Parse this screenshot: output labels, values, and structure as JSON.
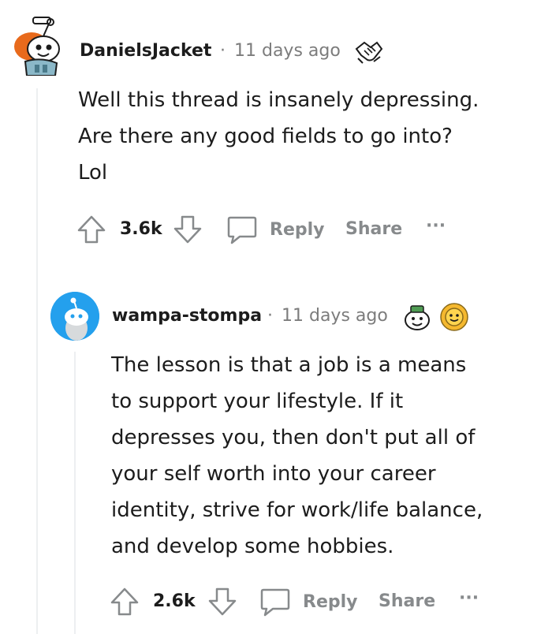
{
  "comments": [
    {
      "username": "DanielsJacket",
      "separator": "·",
      "timestamp": "11 days ago",
      "body_lines": [
        "Well this thread is insanely depressing.",
        "Are there any good fields to go into?",
        "Lol"
      ],
      "vote_count": "3.6k",
      "reply_label": "Reply",
      "share_label": "Share",
      "more_label": "···"
    },
    {
      "username": "wampa-stompa",
      "separator": "·",
      "timestamp": "11 days ago",
      "body_lines": [
        "The lesson is that a job is a means",
        "to support your lifestyle. If it",
        "depresses you, then don't put all of",
        "your self worth into your career",
        "identity, strive for work/life balance,",
        "and develop some hobbies."
      ],
      "vote_count": "2.6k",
      "reply_label": "Reply",
      "share_label": "Share",
      "more_label": "···"
    }
  ],
  "colors": {
    "text": "#1c1c1c",
    "meta": "#7c7c7c",
    "action": "#878a8c",
    "thread_line": "#edeff1",
    "avatar2_bg": "#24a0ed"
  },
  "icons": [
    "snoo-avatar-icon",
    "handshake-award-icon",
    "upvote-icon",
    "downvote-icon",
    "comment-bubble-icon",
    "snoo-avatar-blue-icon",
    "wholesome-award-icon",
    "sun-award-icon"
  ]
}
